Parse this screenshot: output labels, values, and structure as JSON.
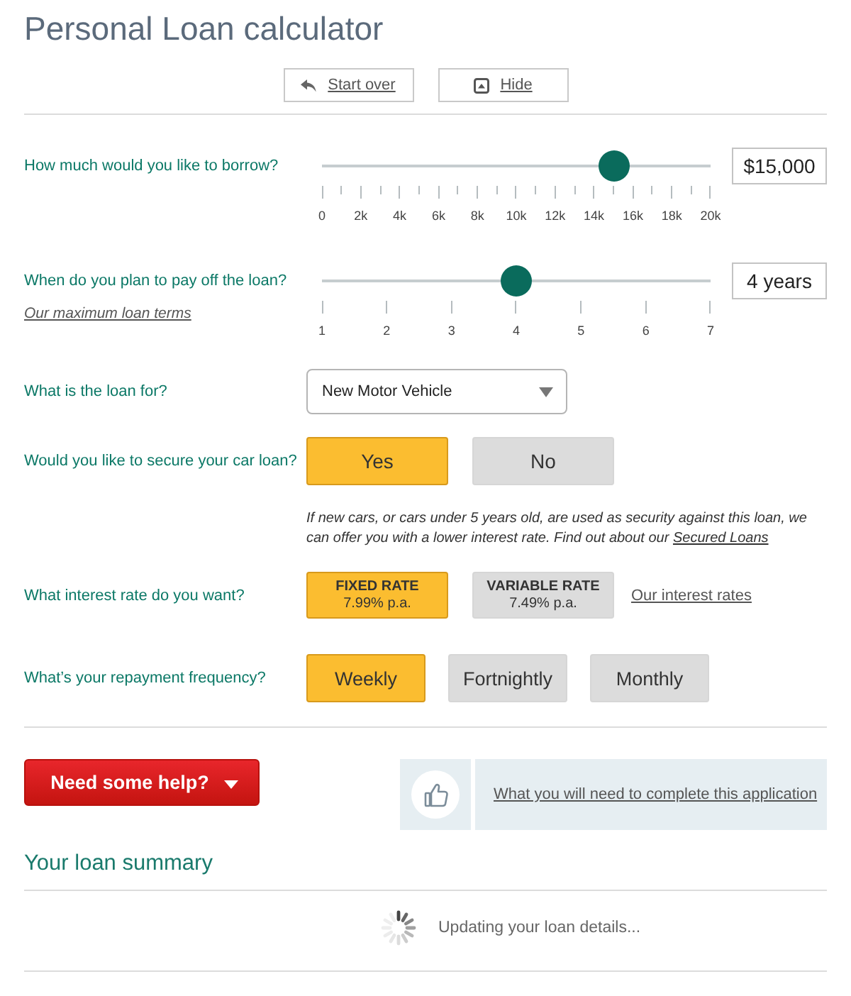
{
  "title": "Personal Loan calculator",
  "toolbar": [
    {
      "kind": "restart",
      "label": "Start over"
    },
    {
      "kind": "hide",
      "label": "Hide"
    }
  ],
  "sliders": [
    {
      "label": "How much would you like to borrow?",
      "level": 0.75,
      "value": "$15,000",
      "minor_ticks": true,
      "scale": [
        "0",
        "2k",
        "4k",
        "6k",
        "8k",
        "10k",
        "12k",
        "14k",
        "16k",
        "18k",
        "20k"
      ]
    },
    {
      "label": "When do you plan to pay off the loan?",
      "link": "Our maximum loan terms",
      "level": 0.5,
      "value": "4 years",
      "minor_ticks": false,
      "scale": [
        "1",
        "2",
        "3",
        "4",
        "5",
        "6",
        "7"
      ]
    }
  ],
  "purpose": {
    "label": "What is the loan for?",
    "value": "New Motor Vehicle"
  },
  "security": {
    "label": "Would you like to secure your car loan?",
    "options": [
      {
        "label": "Yes",
        "selected": true
      },
      {
        "label": "No",
        "selected": false
      }
    ],
    "note": "If new cars, or cars under 5 years old, are used as security against this loan, we can offer you with a lower interest rate. Find out about our",
    "note_link": "Secured Loans"
  },
  "interest": {
    "label": "What interest rate do you want?",
    "options": [
      {
        "label": "FIXED RATE",
        "rate": "7.99% p.a.",
        "selected": true
      },
      {
        "label": "VARIABLE RATE",
        "rate": "7.49% p.a.",
        "selected": false
      }
    ],
    "link": "Our interest rates"
  },
  "frequency": {
    "label": "What’s your repayment frequency?",
    "options": [
      {
        "label": "Weekly",
        "selected": true
      },
      {
        "label": "Fortnightly",
        "selected": false
      },
      {
        "label": "Monthly",
        "selected": false
      }
    ]
  },
  "help": {
    "label": "Need some help?"
  },
  "checklist_link": "What you will need to complete this application",
  "summary": {
    "title": "Your loan summary",
    "loading": true,
    "status": "Updating your loan details..."
  }
}
